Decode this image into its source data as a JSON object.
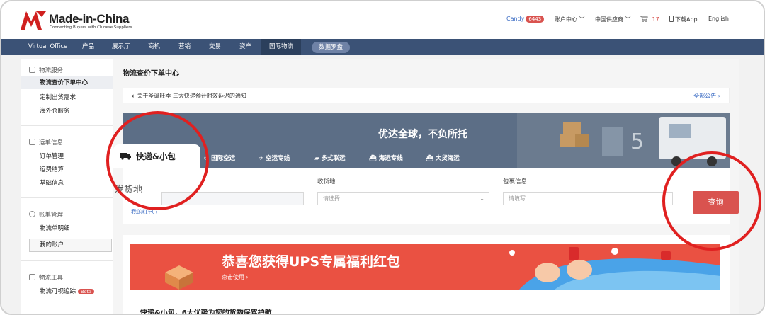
{
  "header": {
    "brand": "Made-in-China",
    "tagline": "Connecting Buyers with Chinese Suppliers",
    "user": "Candy",
    "user_badge": "6443",
    "account_center": "账户中心",
    "china_supplier": "中国供应商",
    "cart_count": "17",
    "download_app": "下载App",
    "language": "English"
  },
  "nav": {
    "items": [
      "Virtual Office",
      "产品",
      "展示厅",
      "商机",
      "营销",
      "交易",
      "资产",
      "国际物流"
    ],
    "pill": "数据罗盘"
  },
  "sidebar": {
    "g1_title": "物流服务",
    "g1_items": [
      "物流查价下单中心",
      "定制出货需求",
      "海外仓服务"
    ],
    "g2_title": "运单信息",
    "g2_items": [
      "订单管理",
      "运费结算",
      "基础信息"
    ],
    "g3_title": "账单管理",
    "g3_items": [
      "物流单明细",
      "我的账户"
    ],
    "g4_title": "物流工具",
    "g4_item": "物流可视追踪",
    "beta": "Beta"
  },
  "page": {
    "title": "物流查价下单中心",
    "notice": "关于圣诞旺季 三大快递预计时效延迟的通知",
    "all_notices": "全部公告",
    "slogan": "优达全球，不负所托"
  },
  "tabs": [
    "快递&小包",
    "国际空运",
    "空运专线",
    "多式联运",
    "海运专线",
    "大货海运"
  ],
  "form": {
    "from_label": "发货地",
    "to_label": "收货地",
    "to_placeholder": "请选择",
    "package_label": "包裹信息",
    "package_placeholder": "请填写",
    "my_red_packet": "我的红包",
    "query": "查询"
  },
  "promo": {
    "headline": "恭喜您获得UPS专属福利红包",
    "cta": "点击使用",
    "advantages": "快递&小包，6大优势为您的货物保驾护航"
  },
  "colors": {
    "nav": "#3b5276",
    "accent": "#d9534f",
    "link": "#3b6cc4",
    "annotation": "#e02020"
  }
}
